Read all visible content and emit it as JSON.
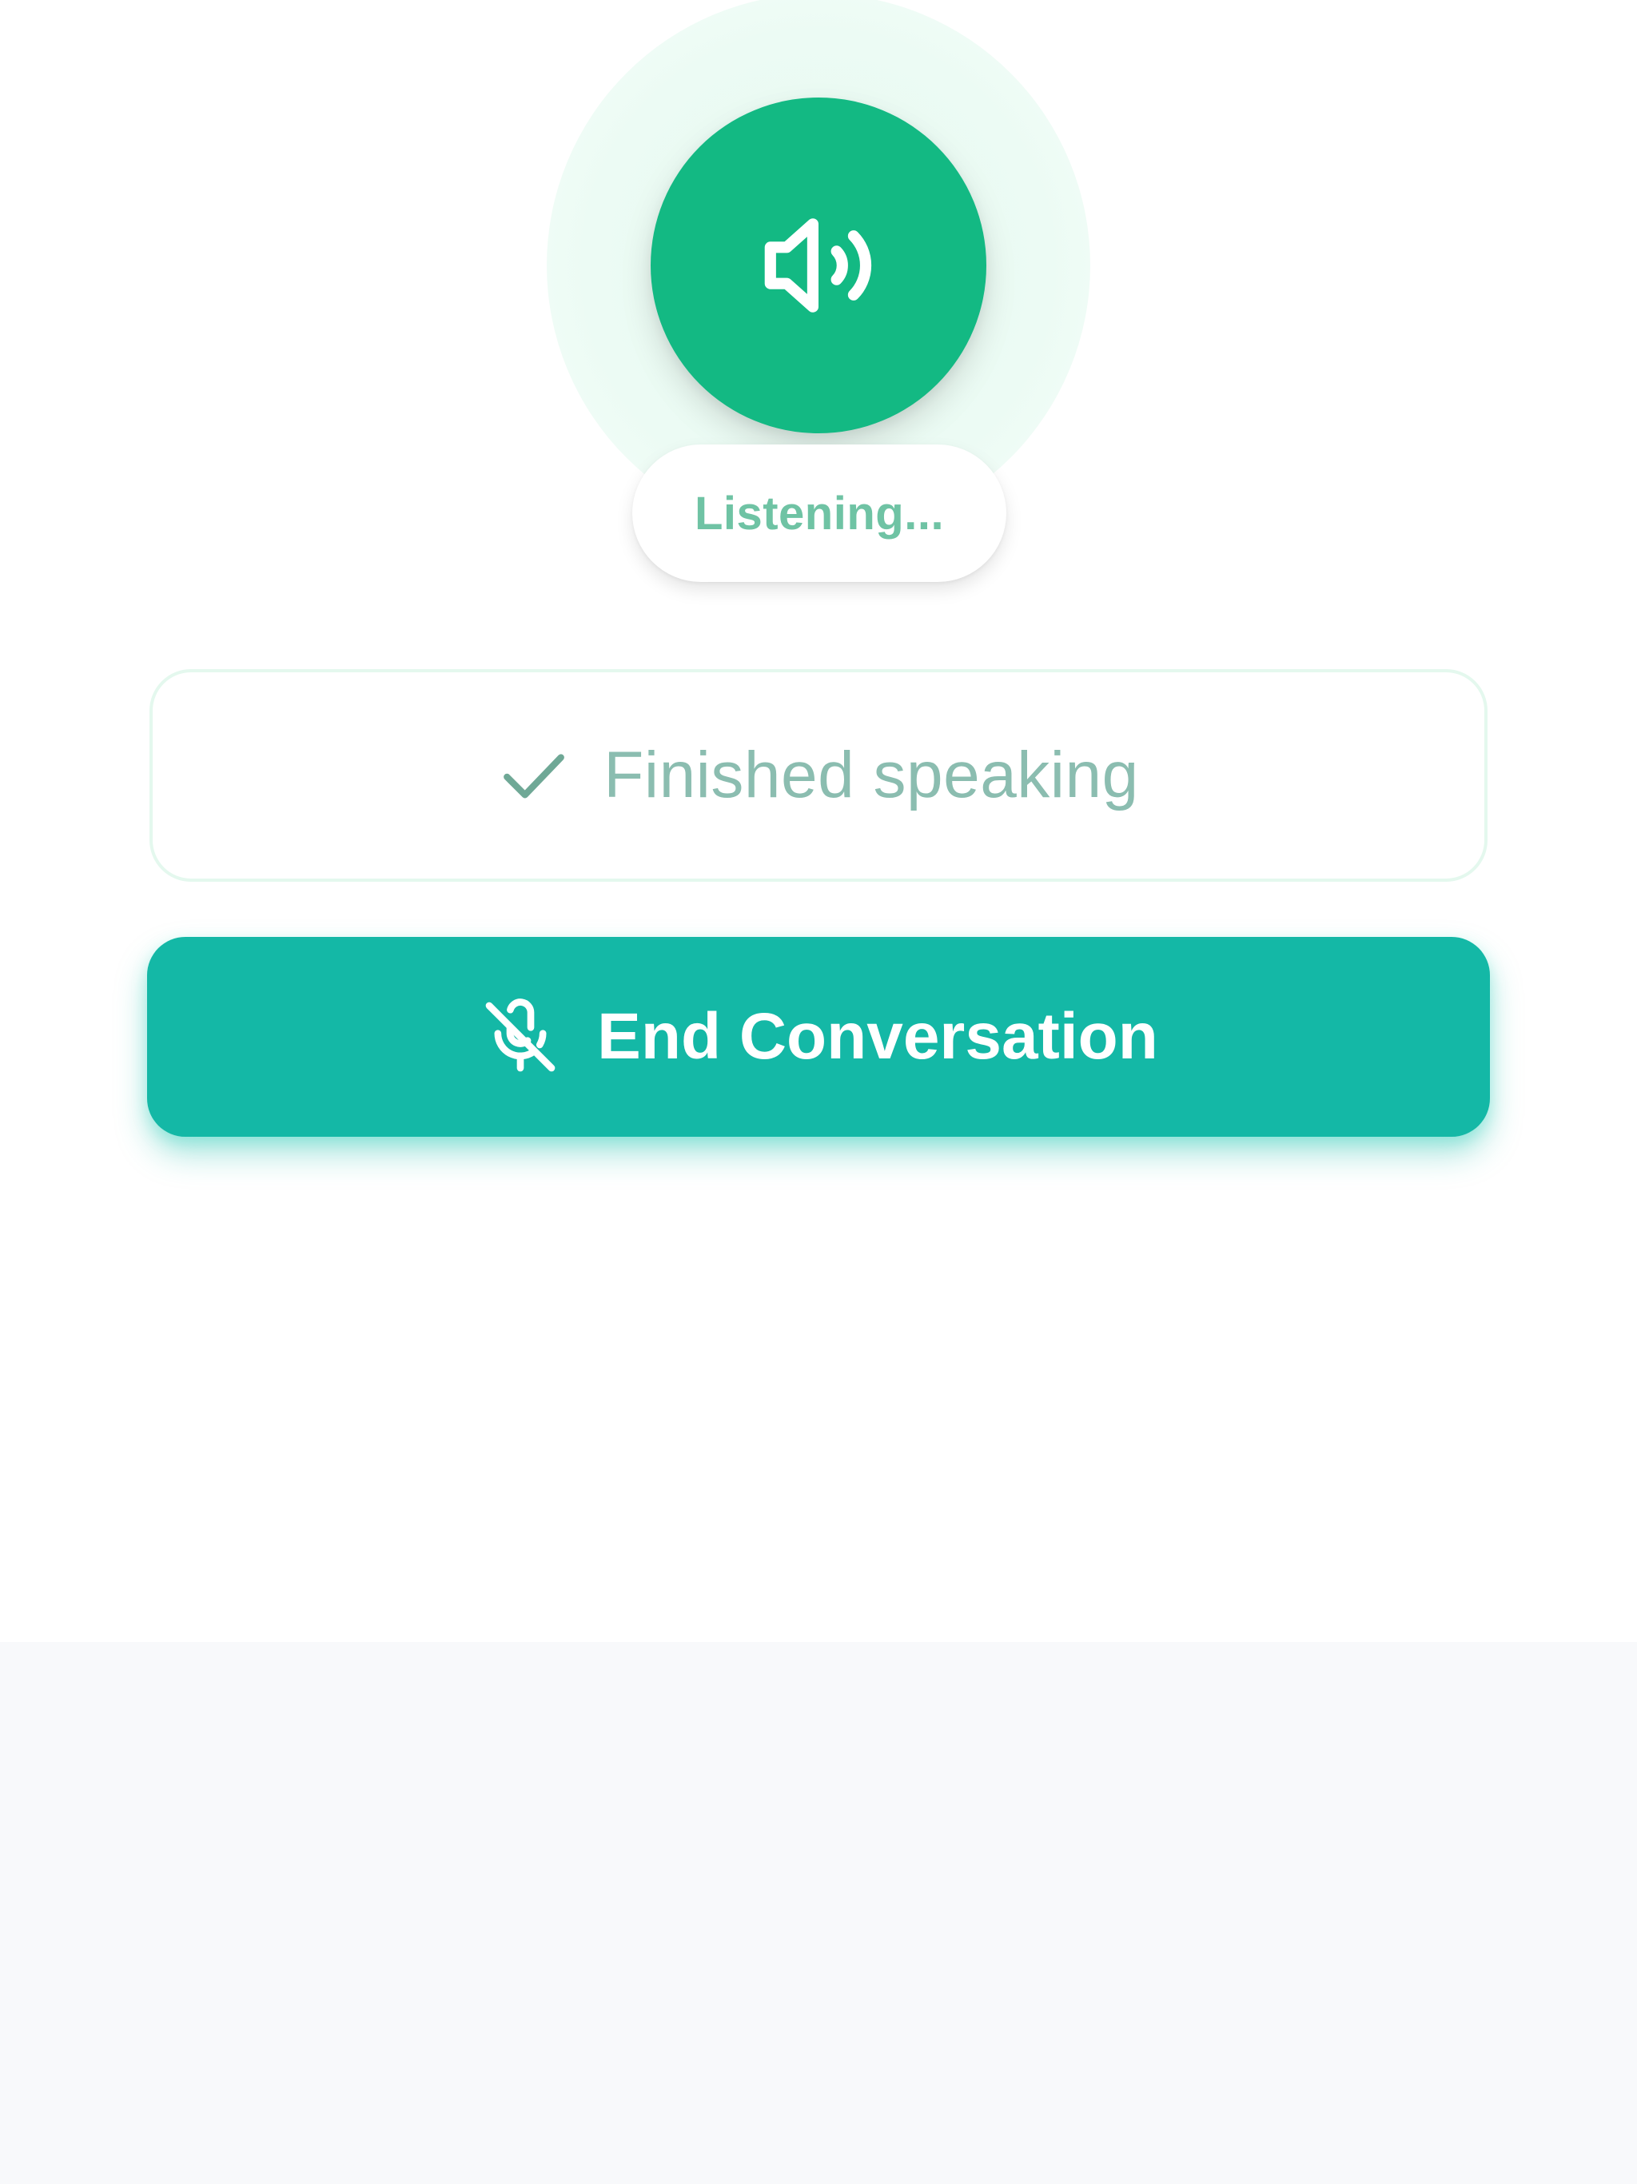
{
  "speaker": {
    "icon": "speaker-volume-icon",
    "color": "#13b983"
  },
  "status": {
    "label": "Listening..."
  },
  "finished": {
    "icon": "check-icon",
    "label": "Finished speaking"
  },
  "end_conversation": {
    "icon": "mic-off-icon",
    "label": "End Conversation",
    "color": "#14b8a6"
  }
}
